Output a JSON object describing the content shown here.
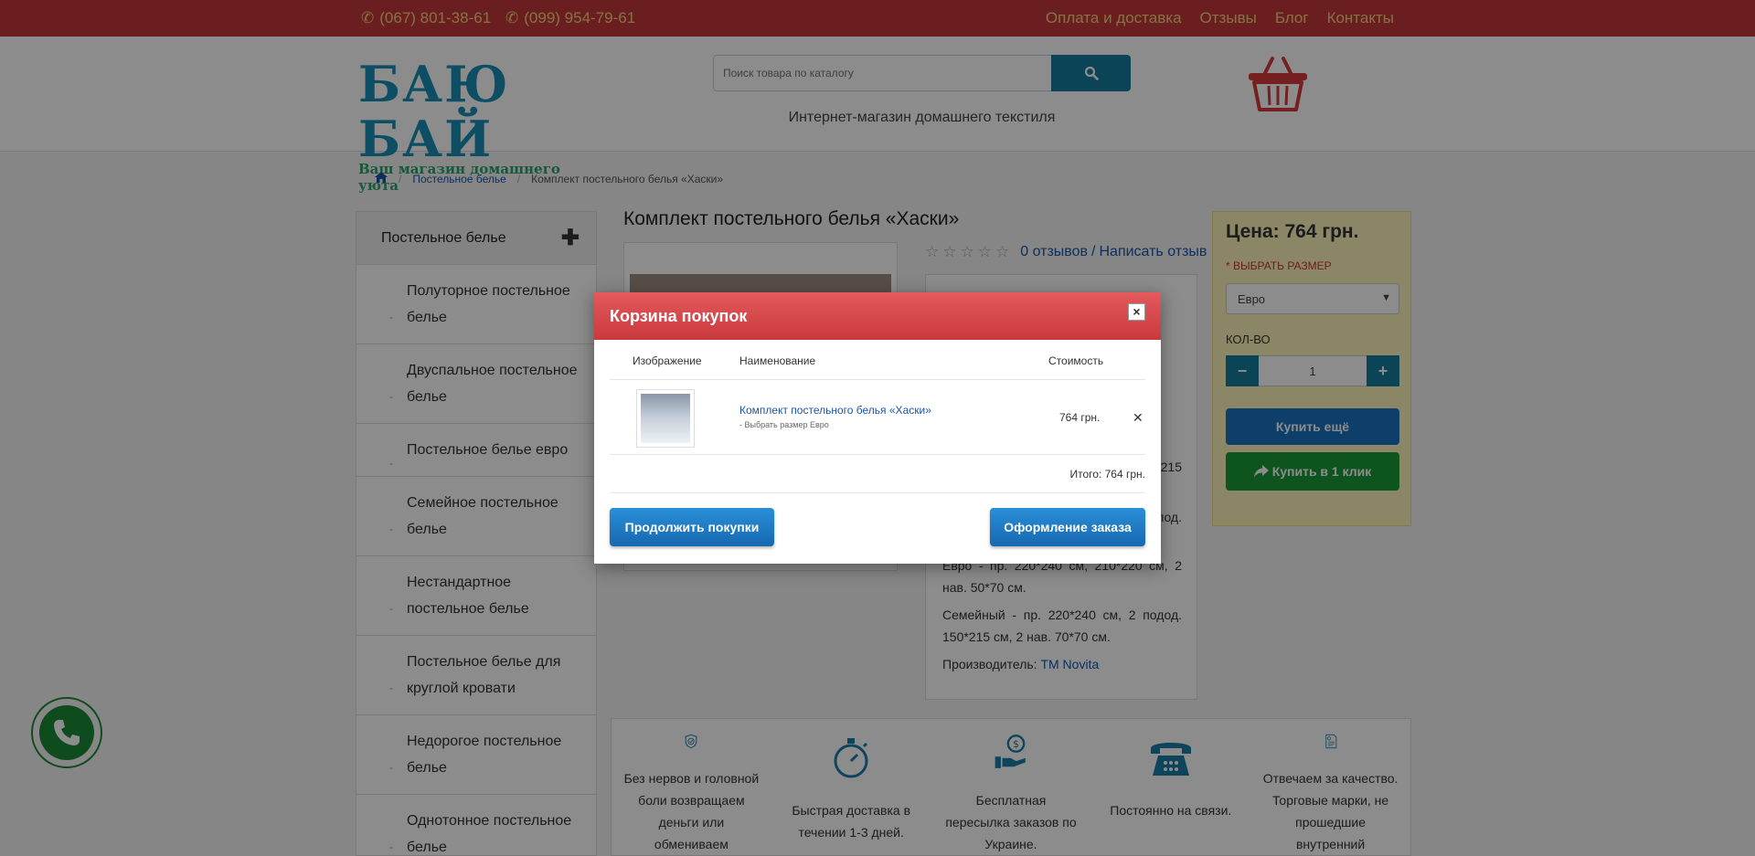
{
  "topbar": {
    "phone1": "(067) 801-38-61",
    "phone2": "(099) 954-79-61",
    "nav": [
      "Оплата и доставка",
      "Отзывы",
      "Блог",
      "Контакты"
    ]
  },
  "header": {
    "logo_main": "БАЮ БАЙ",
    "logo_sub": "Ваш магазин домашнего уюта",
    "search_placeholder": "Поиск товара по каталогу",
    "tagline": "Интернет-магазин домашнего текстиля"
  },
  "breadcrumb": {
    "items": [
      "Постельное белье",
      "Комплект постельного белья «Хаски»"
    ]
  },
  "sidebar": {
    "title": "Постельное белье",
    "items": [
      "Полуторное постельное белье",
      "Двуспальное постельное белье",
      "Постельное белье евро",
      "Семейное постельное белье",
      "Нестандартное постельное белье",
      "Постельное белье для круглой кровати",
      "Недорогое постельное белье",
      "Однотонное постельное белье"
    ]
  },
  "product": {
    "title": "Комплект постельного белья «Хаски»",
    "reviews_link": "0 отзывов",
    "separator": "/",
    "write_review": "Написать отзыв",
    "spec_fragment_1": "215",
    "spec_fragment_2": "под.",
    "spec_euro": "Евро - пр. 220*240 см, 210*220 см, 2 нав. 50*70 см.",
    "spec_family": "Семейный - пр. 220*240 см, 2 подод. 150*215 см, 2 нав. 70*70 см.",
    "manufacturer_label": "Производитель:",
    "manufacturer": "ТМ Novita"
  },
  "price_panel": {
    "price": "Цена: 764 грн.",
    "size_label": "ВЫБРАТЬ РАЗМЕР",
    "required_mark": "*",
    "size_value": "Евро",
    "qty_label": "КОЛ-ВО",
    "qty_value": "1",
    "buy_more": "Купить ещё",
    "one_click": "Купить в 1 клик"
  },
  "benefits": [
    {
      "icon": "shield-check-icon",
      "text": "Без нервов и головной боли возвращаем деньги или обмениваем"
    },
    {
      "icon": "stopwatch-icon",
      "text": "Быстрая доставка в течении 1-3 дней."
    },
    {
      "icon": "money-hand-icon",
      "text": "Бесплатная пересылка заказов по Украине."
    },
    {
      "icon": "telephone-icon",
      "text": "Постоянно на связи."
    },
    {
      "icon": "certificate-icon",
      "text": "Отвечаем за качество. Торговые марки, не прошедшие внутренний"
    }
  ],
  "modal": {
    "title": "Корзина покупок",
    "col_image": "Изображение",
    "col_name": "Наименование",
    "col_price": "Стоимость",
    "item_name": "Комплект постельного белья «Хаски»",
    "item_option": "- Выбрать размер Евро",
    "item_price": "764 грн.",
    "total": "Итого: 764 грн.",
    "continue": "Продолжить покупки",
    "checkout": "Оформление заказа"
  },
  "colors": {
    "topbar": "#c2383b",
    "accent_blue": "#167d9f",
    "modal_header": "#d9474b",
    "buy_green": "#1a9a3a",
    "price_panel": "#fdf4b8"
  }
}
